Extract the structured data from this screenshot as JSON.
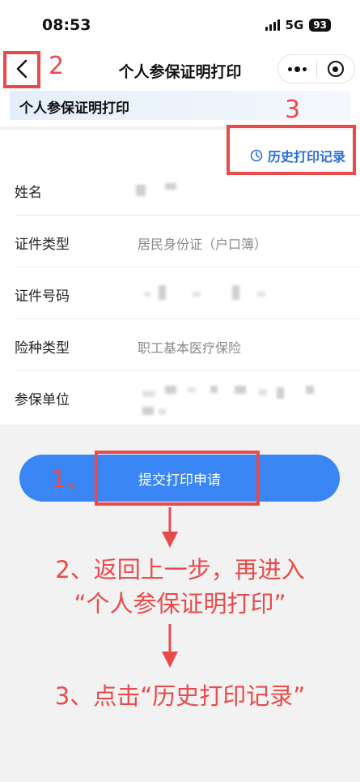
{
  "status": {
    "time": "08:53",
    "network": "5G",
    "battery": "93"
  },
  "nav": {
    "title": "个人参保证明打印"
  },
  "section": {
    "title": "个人参保证明打印"
  },
  "history": {
    "label": "历史打印记录"
  },
  "form": {
    "rows": [
      {
        "label": "姓名",
        "value": ""
      },
      {
        "label": "证件类型",
        "value": "居民身份证（户口簿）"
      },
      {
        "label": "证件号码",
        "value": ""
      },
      {
        "label": "险种类型",
        "value": "职工基本医疗保险"
      },
      {
        "label": "参保单位",
        "value": ""
      }
    ]
  },
  "submit": {
    "label": "提交打印申请"
  },
  "annotations": {
    "num_back": "2",
    "num_history": "3",
    "num_submit": "1、",
    "step2_line1": "2、返回上一步，再进入",
    "step2_line2": "“个人参保证明打印”",
    "step3": "3、点击“历史打印记录”",
    "color": "#e94b4b"
  }
}
